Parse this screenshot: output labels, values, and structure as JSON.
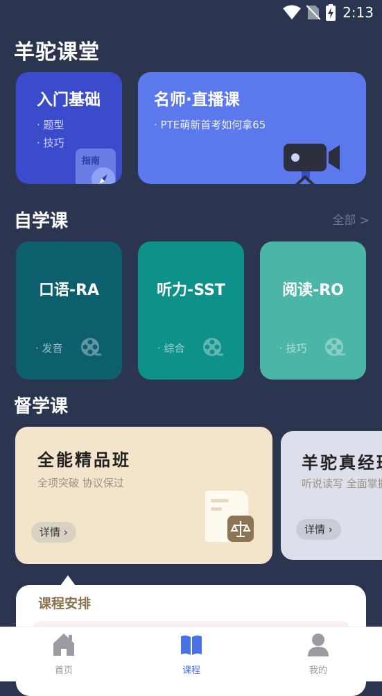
{
  "status_bar": {
    "time": "2:13"
  },
  "app_title": "羊驼课堂",
  "top_cards": {
    "basic": {
      "title": "入门基础",
      "items": [
        "· 题型",
        "· 技巧"
      ],
      "badge": "指南"
    },
    "live": {
      "title": "名师·直播课",
      "item": "· PTE萌新首考如何拿65"
    }
  },
  "self_study": {
    "title": "自学课",
    "see_all": "全部 >",
    "cards": [
      {
        "title": "口语-RA",
        "tag": "· 发音",
        "color": "#0d5f6e"
      },
      {
        "title": "听力-SST",
        "tag": "· 综合",
        "color": "#0d9188"
      },
      {
        "title": "阅读-RO",
        "tag": "· 技巧",
        "color": "#4bb5a8"
      }
    ]
  },
  "supervised": {
    "title": "督学课",
    "cards": [
      {
        "title": "全能精品班",
        "subtitle": "全项突破 协议保过",
        "detail": "详情"
      },
      {
        "title": "羊驼真经班",
        "subtitle": "听说读写 全面掌握",
        "detail": "详情"
      }
    ]
  },
  "schedule": {
    "title": "课程安排"
  },
  "bottom_nav": [
    {
      "label": "首页",
      "icon": "home-icon",
      "active": false
    },
    {
      "label": "课程",
      "icon": "book-icon",
      "active": true
    },
    {
      "label": "我的",
      "icon": "person-icon",
      "active": false
    }
  ],
  "colors": {
    "background": "#2c3550",
    "accent": "#4a72e8",
    "basic_card": "#3a4bcc",
    "live_card": "#5b78ec"
  }
}
